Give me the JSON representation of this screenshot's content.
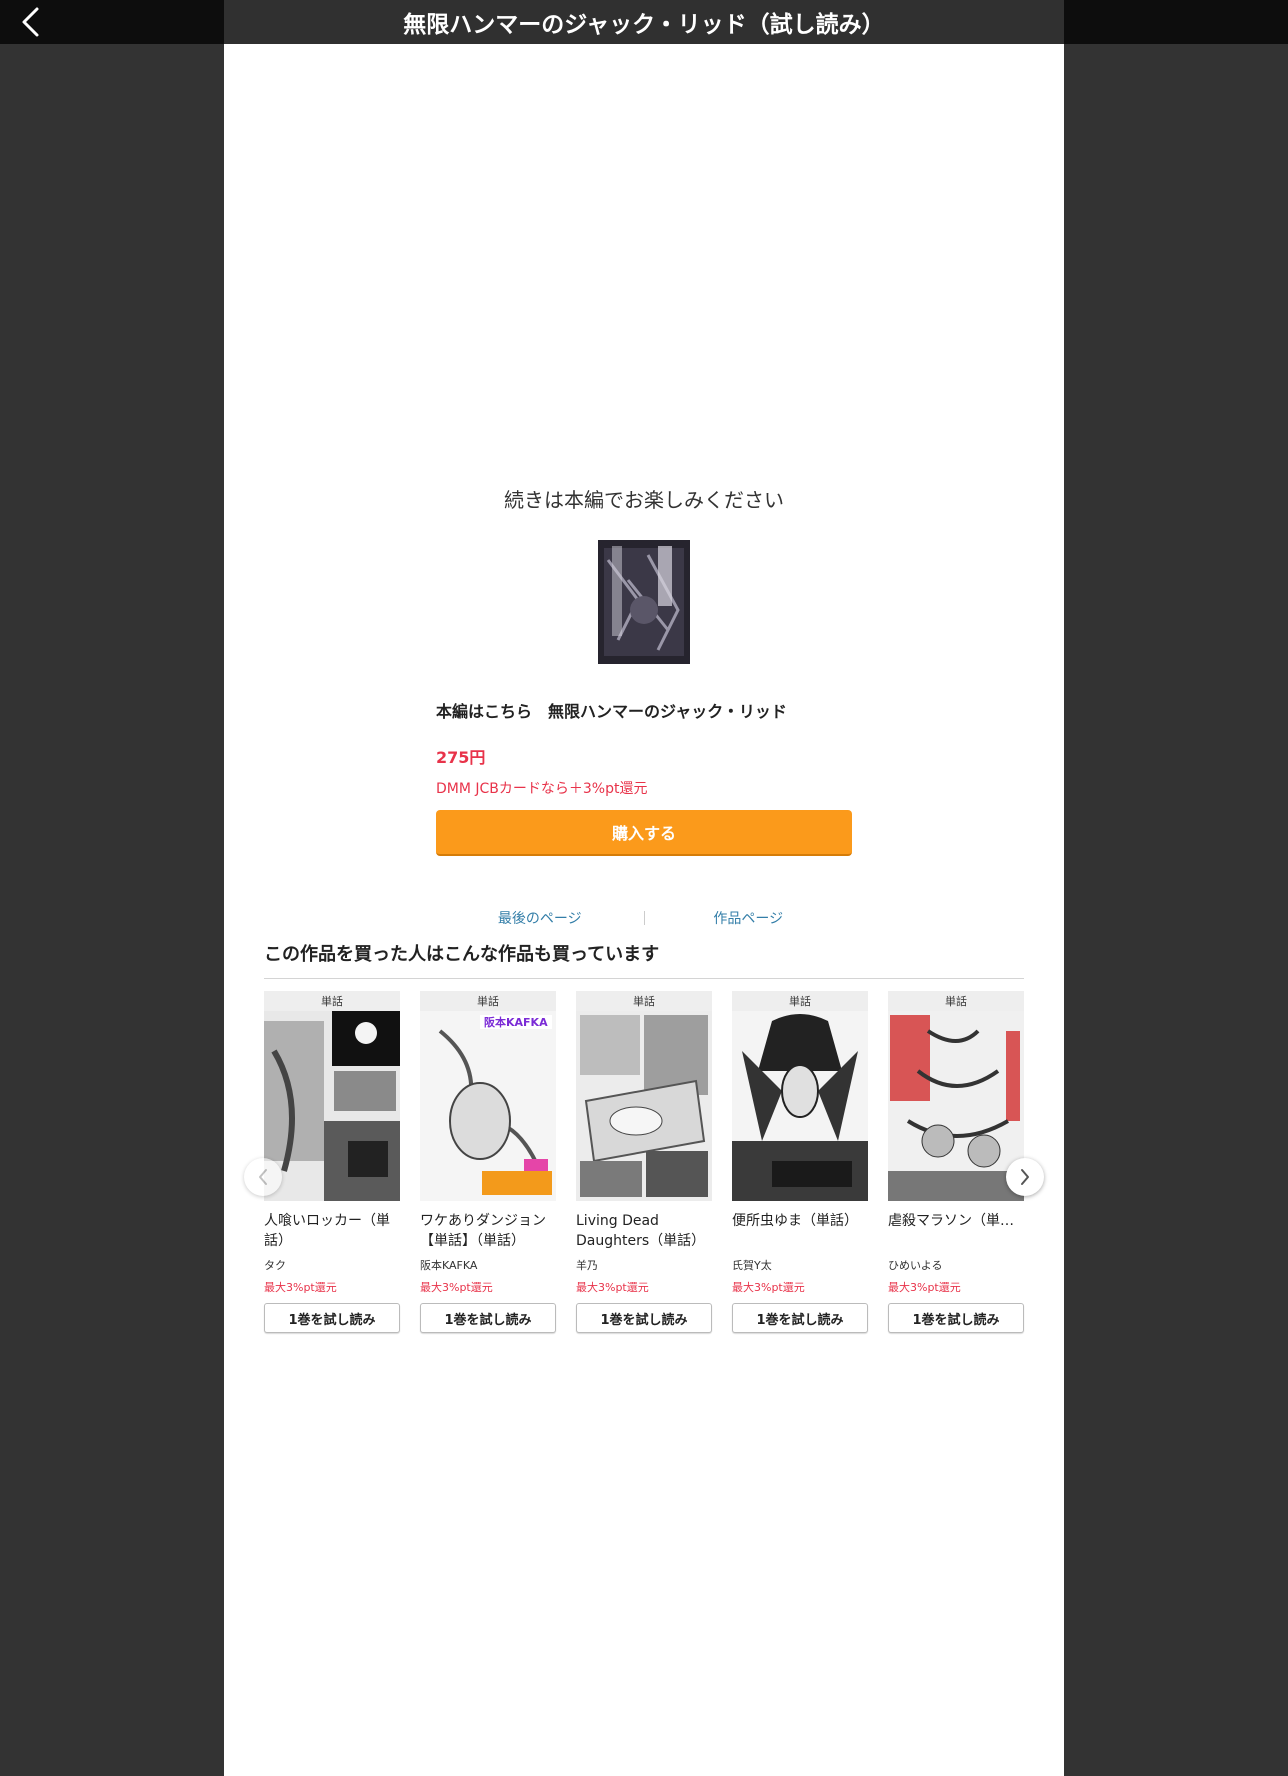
{
  "header": {
    "title": "無限ハンマーのジャック・リッド（試し読み）",
    "back_icon": "chevron-left-icon"
  },
  "end_panel": {
    "continue_text": "続きは本編でお楽しみください",
    "purchase_title": "本編はこちら　無限ハンマーのジャック・リッド",
    "price": "275円",
    "jcb_note": "DMM JCBカードなら＋3%pt還元",
    "buy_label": "購入する",
    "last_page_link": "最後のページ",
    "work_page_link": "作品ページ"
  },
  "recommendations": {
    "heading": "この作品を買った人はこんな作品も買っています",
    "items": [
      {
        "tag": "単話",
        "title": "人喰いロッカー（単話）",
        "author": "タク",
        "reward": "最大3%pt還元",
        "button": "1巻を試し読み"
      },
      {
        "tag": "単話",
        "title": "ワケありダンジョン【単話】（単話）",
        "author": "阪本KAFKA",
        "reward": "最大3%pt還元",
        "button": "1巻を試し読み"
      },
      {
        "tag": "単話",
        "title": "Living Dead Daughters（単話）",
        "author": "羊乃",
        "reward": "最大3%pt還元",
        "button": "1巻を試し読み"
      },
      {
        "tag": "単話",
        "title": "便所虫ゆま（単話）",
        "author": "氏賀Y太",
        "reward": "最大3%pt還元",
        "button": "1巻を試し読み"
      },
      {
        "tag": "単話",
        "title": "虐殺マラソン（単…",
        "author": "ひめいよる",
        "reward": "最大3%pt還元",
        "button": "1巻を試し読み"
      }
    ],
    "prev_icon": "chevron-left-icon",
    "next_icon": "chevron-right-icon"
  },
  "colors": {
    "accent_orange": "#fb9a1b",
    "price_red": "#e8334a",
    "link_blue": "#337ea8",
    "background": "#333333",
    "topbar": "#0d0d0d"
  }
}
